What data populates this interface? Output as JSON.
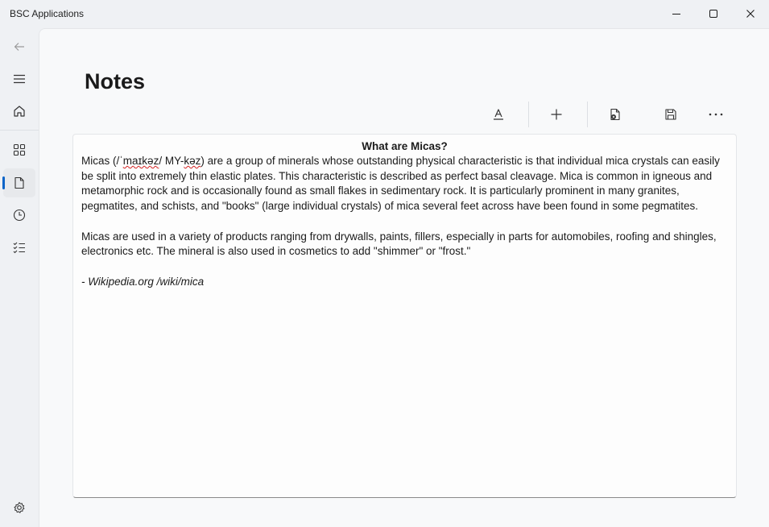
{
  "window": {
    "title": "BSC Applications",
    "controls": [
      "minimize",
      "maximize",
      "close"
    ]
  },
  "sidebar": {
    "items": [
      {
        "name": "back",
        "icon": "back-arrow-icon"
      },
      {
        "name": "menu",
        "icon": "hamburger-icon"
      },
      {
        "name": "home",
        "icon": "home-icon"
      },
      {
        "name": "apps",
        "icon": "grid-icon"
      },
      {
        "name": "notes",
        "icon": "document-icon",
        "selected": true
      },
      {
        "name": "history",
        "icon": "clock-icon"
      },
      {
        "name": "tasks",
        "icon": "checklist-icon"
      },
      {
        "name": "settings",
        "icon": "gear-icon"
      }
    ],
    "accent": "#0a64c8"
  },
  "page": {
    "title": "Notes"
  },
  "toolbar": {
    "buttons": [
      {
        "name": "font-format",
        "icon": "text-format-icon"
      },
      {
        "name": "add",
        "icon": "plus-icon"
      },
      {
        "name": "open",
        "icon": "open-file-icon"
      },
      {
        "name": "save",
        "icon": "save-icon"
      },
      {
        "name": "more",
        "icon": "more-ellipsis-icon"
      }
    ]
  },
  "note": {
    "title": "What are Micas?",
    "p1_pre": "Micas (/ˈ",
    "p1_sq1": "maɪkəz",
    "p1_mid": "/ MY-",
    "p1_sq2": "kəz",
    "p1_rest": ") are a group of minerals whose outstanding physical characteristic is that individual mica crystals can easily be split into extremely thin elastic plates. This characteristic is described as perfect basal cleavage. Mica is common in igneous and metamorphic rock and is occasionally found as small flakes in sedimentary rock. It is particularly prominent in many granites, pegmatites, and schists, and \"books\" (large individual crystals) of mica several feet across have been found in some pegmatites.",
    "p2": "Micas are used in a variety of products ranging from drywalls, paints, fillers, especially in parts for automobiles, roofing and shingles, electronics etc. The mineral is also used in cosmetics to add \"shimmer\" or \"frost.\"",
    "attribution": "- Wikipedia.org /wiki/mica"
  }
}
